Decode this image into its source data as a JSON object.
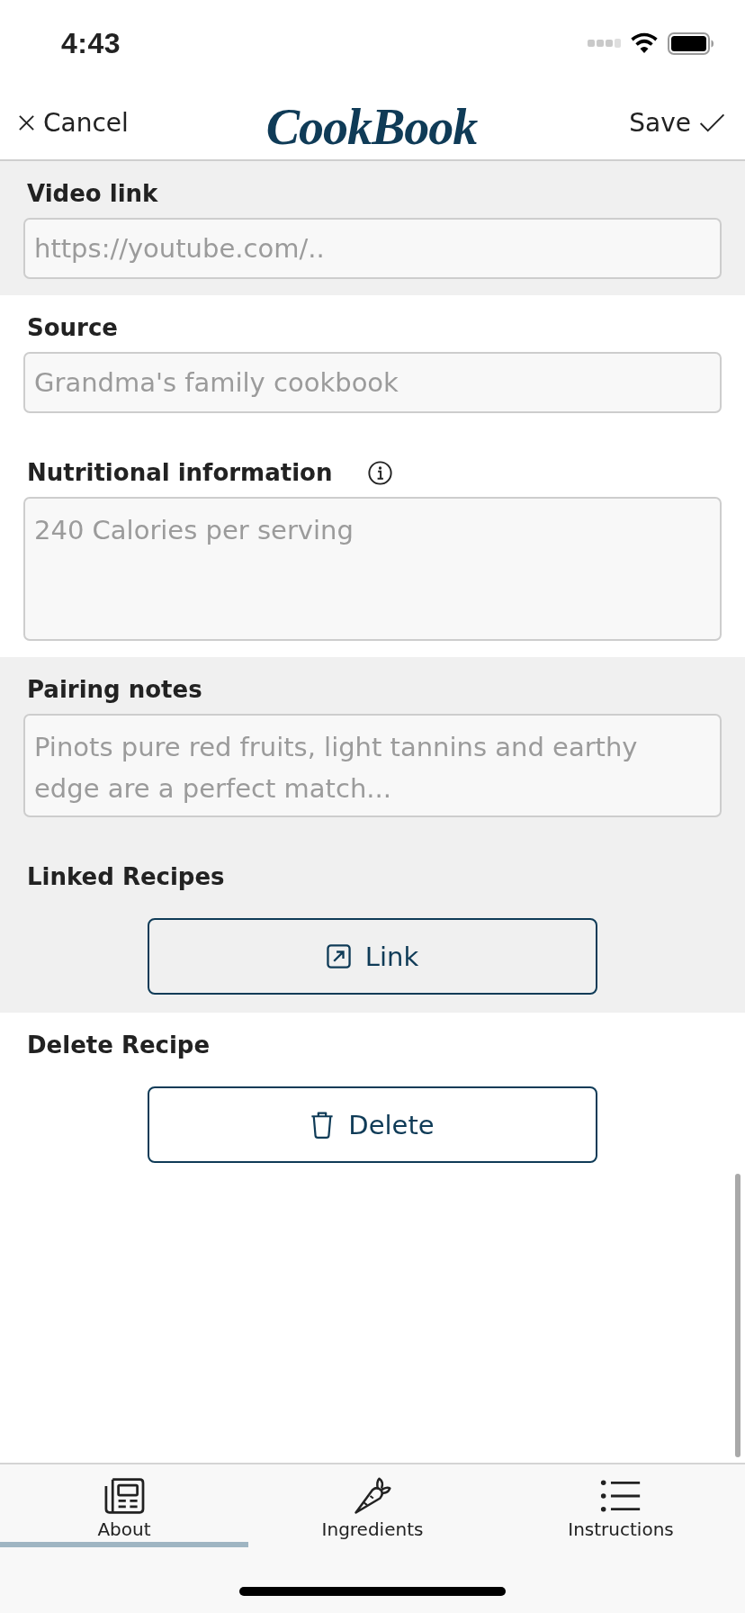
{
  "status_bar": {
    "time": "4:43"
  },
  "header": {
    "cancel": "Cancel",
    "logo": "CookBook",
    "save": "Save"
  },
  "sections": [
    {
      "shaded": true,
      "fields": [
        {
          "kind": "input",
          "label": "Video link",
          "info": false,
          "placeholder": "https://youtube.com/.."
        }
      ]
    },
    {
      "shaded": false,
      "fields": [
        {
          "kind": "input",
          "label": "Source",
          "info": false,
          "placeholder": "Grandma's family cookbook"
        },
        {
          "kind": "textarea",
          "label": "Nutritional information",
          "info": true,
          "placeholder": "240 Calories per serving"
        }
      ]
    },
    {
      "shaded": true,
      "fields": [
        {
          "kind": "textarea",
          "label": "Pairing notes",
          "info": false,
          "placeholder": "Pinots pure red fruits, light tannins and earthy edge are a perfect match..."
        },
        {
          "kind": "link",
          "label": "Linked Recipes",
          "info": false,
          "button": "Link"
        }
      ]
    },
    {
      "shaded": false,
      "fields": [
        {
          "kind": "delete",
          "label": "Delete Recipe",
          "info": false,
          "button": "Delete"
        }
      ]
    }
  ],
  "tabs": [
    {
      "label": "About",
      "selected": true
    },
    {
      "label": "Ingredients",
      "selected": false
    },
    {
      "label": "Instructions",
      "selected": false
    }
  ]
}
